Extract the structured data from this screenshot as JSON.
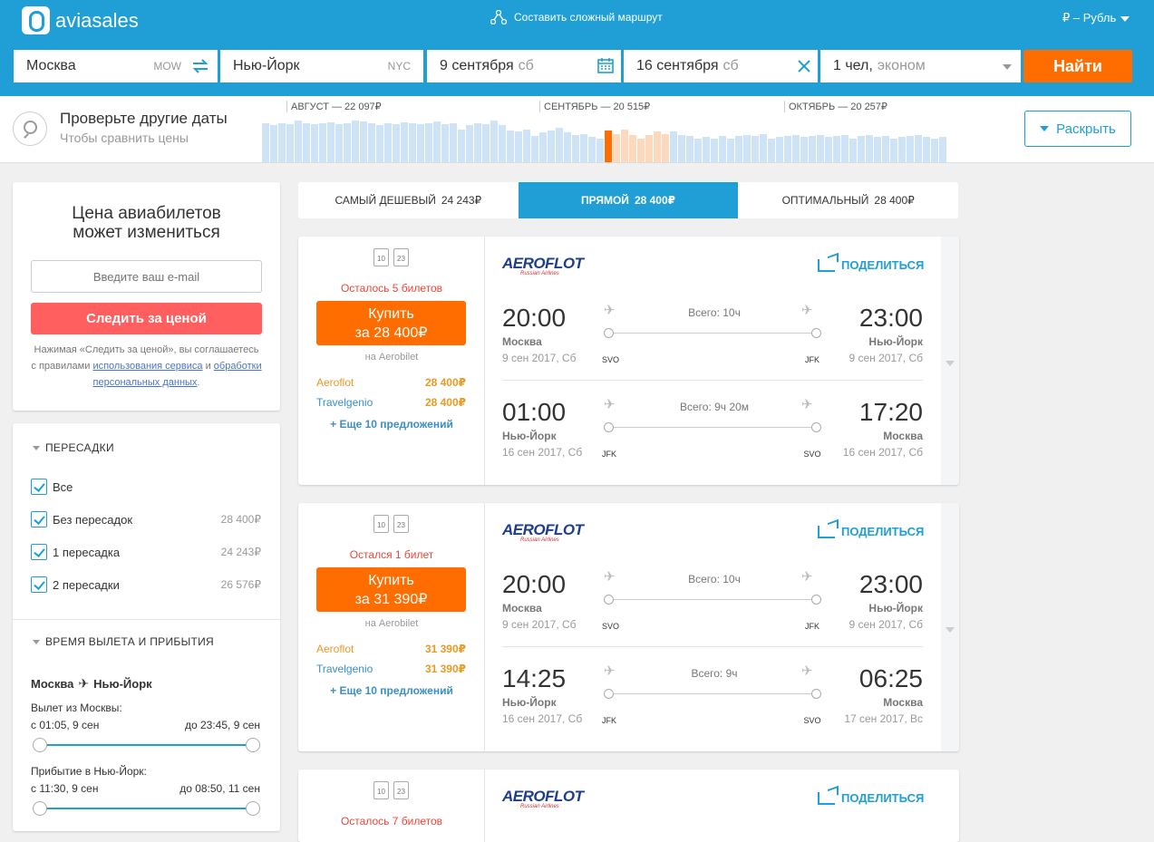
{
  "header": {
    "logo": "aviasales",
    "complex_route": "Составить сложный маршрут",
    "currency": "₽ – Рубль"
  },
  "search": {
    "from": "Москва",
    "from_code": "MOW",
    "to": "Нью-Йорк",
    "to_code": "NYC",
    "depart": "9 сентября",
    "depart_day": "сб",
    "return": "16 сентября",
    "return_day": "сб",
    "passengers": "1 чел,",
    "class": "эконом",
    "find": "Найти"
  },
  "dates": {
    "title": "Проверьте другие даты",
    "subtitle": "Чтобы сравнить цены",
    "months": [
      "АВГУСТ — 22 097₽",
      "СЕНТЯБРЬ — 20 515₽",
      "ОКТЯБРЬ — 20 257₽"
    ],
    "expand": "Раскрыть",
    "bars": [
      0.9,
      0.85,
      0.9,
      0.88,
      0.95,
      0.9,
      0.87,
      0.9,
      0.92,
      0.88,
      0.9,
      0.95,
      0.93,
      0.9,
      0.85,
      0.9,
      0.88,
      0.92,
      0.9,
      0.87,
      0.9,
      0.93,
      0.88,
      0.9,
      0.75,
      0.85,
      0.9,
      0.88,
      0.95,
      0.85,
      0.72,
      0.7,
      0.75,
      0.6,
      0.68,
      0.72,
      0.8,
      0.68,
      0.62,
      0.65,
      0.58,
      0.55,
      0.72,
      0.65,
      0.75,
      0.62,
      0.55,
      0.62,
      0.7,
      0.65,
      0.7,
      0.62,
      0.6,
      0.55,
      0.58,
      0.55,
      0.6,
      0.55,
      0.6,
      0.62,
      0.6,
      0.65,
      0.55,
      0.58,
      0.6,
      0.62,
      0.58,
      0.6,
      0.62,
      0.58,
      0.6,
      0.62,
      0.55,
      0.6,
      0.62,
      0.58,
      0.6,
      0.55,
      0.58,
      0.6,
      0.62,
      0.58,
      0.55,
      0.58
    ]
  },
  "price_alert": {
    "title1": "Цена авиабилетов",
    "title2": "может измениться",
    "placeholder": "Введите ваш e-mail",
    "button": "Следить за ценой",
    "terms1": "Нажимая «Следить за ценой», вы соглашаетесь с правилами ",
    "terms_link1": "использования сервиса",
    "terms_mid": " и ",
    "terms_link2": "обработки персональных данных",
    "terms_end": "."
  },
  "filters": {
    "stops_title": "ПЕРЕСАДКИ",
    "stops": [
      {
        "label": "Все",
        "price": ""
      },
      {
        "label": "Без пересадок",
        "price": "28 400₽"
      },
      {
        "label": "1 пересадка",
        "price": "24 243₽"
      },
      {
        "label": "2 пересадки",
        "price": "26 576₽"
      }
    ],
    "time_title": "ВРЕМЯ ВЫЛЕТА И ПРИБЫТИЯ",
    "route_from": "Москва",
    "route_to": "Нью-Йорк",
    "depart_label": "Вылет из Москвы:",
    "depart_from": "с 01:05, 9 сен",
    "depart_to": "до 23:45, 9 сен",
    "arrive_label": "Прибытие в Нью-Йорк:",
    "arrive_from": "с 11:30, 9 сен",
    "arrive_to": "до 08:50, 11 сен"
  },
  "tabs": [
    {
      "label": "САМЫЙ ДЕШЕВЫЙ",
      "price": "24 243₽"
    },
    {
      "label": "ПРЯМОЙ",
      "price": "28 400₽"
    },
    {
      "label": "ОПТИМАЛЬНЫЙ",
      "price": "28 400₽"
    }
  ],
  "tickets": [
    {
      "bag1": "10",
      "bag2": "23",
      "remaining": "Осталось 5 билетов",
      "buy1": "Купить",
      "buy2": "за 28 400₽",
      "via": "на Aerobilet",
      "agencies": [
        {
          "name": "Aeroflot",
          "price": "28 400₽"
        },
        {
          "name": "Travelgenio",
          "price": "28 400₽"
        }
      ],
      "more": "+ Еще 10 предложений",
      "airline": "AEROFLOT",
      "airline_sub": "Russian Airlines",
      "share": "ПОДЕЛИТЬСЯ",
      "legs": [
        {
          "dep": "20:00",
          "arr": "23:00",
          "from": "Москва",
          "to": "Нью-Йорк",
          "dep_date": "9 сен 2017, Сб",
          "arr_date": "9 сен 2017, Сб",
          "duration": "Всего: 10ч",
          "from_code": "SVO",
          "to_code": "JFK"
        },
        {
          "dep": "01:00",
          "arr": "17:20",
          "from": "Нью-Йорк",
          "to": "Москва",
          "dep_date": "16 сен 2017, Сб",
          "arr_date": "16 сен 2017, Сб",
          "duration": "Всего: 9ч 20м",
          "from_code": "JFK",
          "to_code": "SVO"
        }
      ]
    },
    {
      "bag1": "10",
      "bag2": "23",
      "remaining": "Остался 1 билет",
      "buy1": "Купить",
      "buy2": "за 31 390₽",
      "via": "на Aerobilet",
      "agencies": [
        {
          "name": "Aeroflot",
          "price": "31 390₽"
        },
        {
          "name": "Travelgenio",
          "price": "31 390₽"
        }
      ],
      "more": "+ Еще 10 предложений",
      "airline": "AEROFLOT",
      "airline_sub": "Russian Airlines",
      "share": "ПОДЕЛИТЬСЯ",
      "legs": [
        {
          "dep": "20:00",
          "arr": "23:00",
          "from": "Москва",
          "to": "Нью-Йорк",
          "dep_date": "9 сен 2017, Сб",
          "arr_date": "9 сен 2017, Сб",
          "duration": "Всего: 10ч",
          "from_code": "SVO",
          "to_code": "JFK"
        },
        {
          "dep": "14:25",
          "arr": "06:25",
          "from": "Нью-Йорк",
          "to": "Москва",
          "dep_date": "16 сен 2017, Сб",
          "arr_date": "17 сен 2017, Вс",
          "duration": "Всего: 9ч",
          "from_code": "JFK",
          "to_code": "SVO"
        }
      ]
    },
    {
      "bag1": "10",
      "bag2": "23",
      "remaining": "Осталось 7 билетов",
      "airline": "AEROFLOT",
      "airline_sub": "Russian Airlines",
      "share": "ПОДЕЛИТЬСЯ"
    }
  ]
}
